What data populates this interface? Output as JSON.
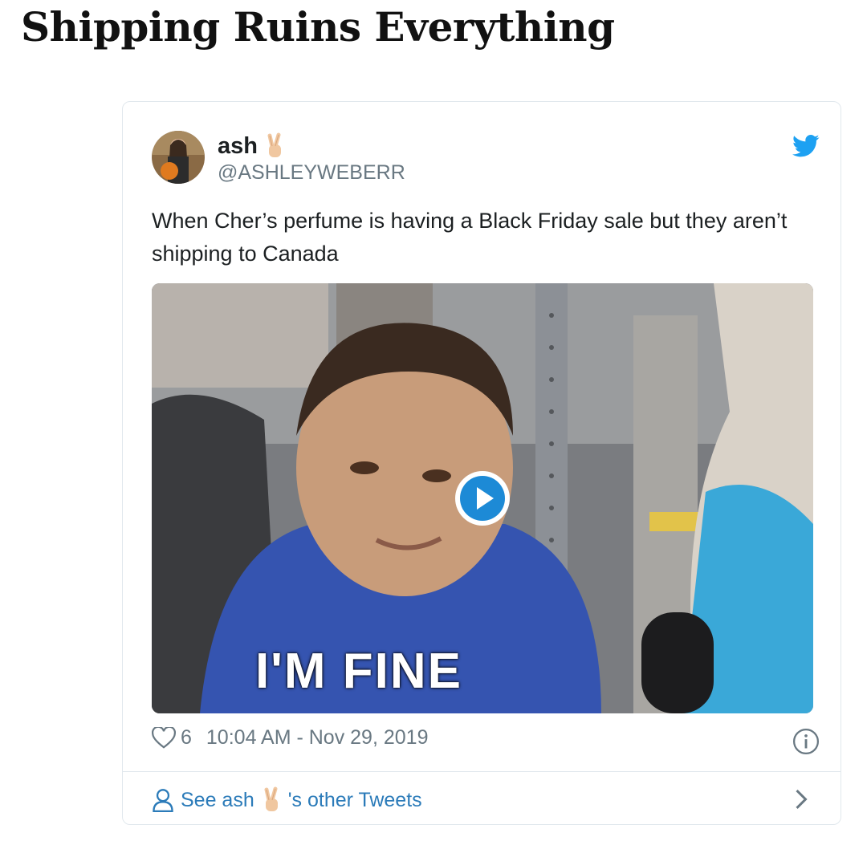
{
  "article": {
    "title": "Shipping Ruins Everything"
  },
  "tweet": {
    "author_name": "ash",
    "author_handle": "@ASHLEYWEBERR",
    "name_emoji": "victory-hand-emoji",
    "text": "When Cher’s perfume is having a Black Friday sale but they aren’t shipping to Canada",
    "media_caption": "I'M FINE",
    "likes": "6",
    "timestamp": "10:04 AM - Nov 29, 2019",
    "footer": {
      "prefix": "See ash",
      "suffix": "'s other Tweets"
    }
  },
  "colors": {
    "twitter_blue": "#1da1f2",
    "link_blue": "#2b7bb9",
    "muted": "#697882",
    "text": "#1c2022",
    "border": "#e1e8ed"
  },
  "icons": [
    "twitter-bird-icon",
    "play-icon",
    "heart-icon",
    "info-icon",
    "person-icon",
    "chevron-right-icon",
    "victory-hand-emoji"
  ]
}
